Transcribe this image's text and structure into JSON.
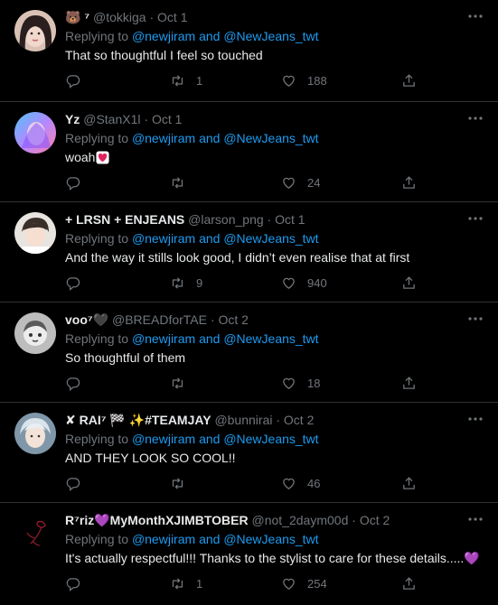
{
  "colors": {
    "background": "#000000",
    "divider": "#2f3336",
    "text_primary": "#e7e9ea",
    "text_secondary": "#71767b",
    "link": "#1d9bf0"
  },
  "icons": {
    "more": "ellipsis-icon",
    "reply": "reply-icon",
    "retweet": "retweet-icon",
    "like": "heart-icon",
    "share": "share-icon"
  },
  "tweets": [
    {
      "display_name": "🐻 ⁷",
      "handle": "@tokkiga",
      "dot": "·",
      "date": "Oct 1",
      "replying_prefix": "Replying to",
      "mention1": "@newjiram",
      "replying_and": "and",
      "mention2": "@NewJeans_twt",
      "text": "That so thoughtful I feel so touched",
      "retweets": "1",
      "likes": "188"
    },
    {
      "display_name": "Yz",
      "handle": "@StanX1l",
      "dot": "·",
      "date": "Oct 1",
      "replying_prefix": "Replying to",
      "mention1": "@newjiram",
      "replying_and": "and",
      "mention2": "@NewJeans_twt",
      "text": "woah",
      "retweets": "",
      "likes": "24"
    },
    {
      "display_name": "+ LRSN + ENJEANS",
      "handle": "@larson_png",
      "dot": "·",
      "date": "Oct 1",
      "replying_prefix": "Replying to",
      "mention1": "@newjiram",
      "replying_and": "and",
      "mention2": "@NewJeans_twt",
      "text": "And the way it stills look good, I didn’t even realise that at first",
      "retweets": "9",
      "likes": "940"
    },
    {
      "display_name": "voo⁷🖤",
      "handle": "@BREADforTAE",
      "dot": "·",
      "date": "Oct 2",
      "replying_prefix": "Replying to",
      "mention1": "@newjiram",
      "replying_and": "and",
      "mention2": "@NewJeans_twt",
      "text": "So thoughtful of them",
      "retweets": "",
      "likes": "18"
    },
    {
      "display_name": "✘ RAI⁷ 🏁 ✨#TEAMJAY",
      "handle": "@bunnirai",
      "dot": "·",
      "date": "Oct 2",
      "replying_prefix": "Replying to",
      "mention1": "@newjiram",
      "replying_and": "and",
      "mention2": "@NewJeans_twt",
      "text": "AND THEY LOOK SO COOL!!",
      "retweets": "",
      "likes": "46"
    },
    {
      "display_name": "R⁷riz💜MyMonthXJIMBTOBER",
      "handle": "@not_2daym00d",
      "dot": "·",
      "date": "Oct 2",
      "replying_prefix": "Replying to",
      "mention1": "@newjiram",
      "replying_and": "and",
      "mention2": "@NewJeans_twt",
      "text": "It's actually respectful!!!  Thanks to the stylist to care for these details.....💜",
      "retweets": "1",
      "likes": "254"
    }
  ]
}
